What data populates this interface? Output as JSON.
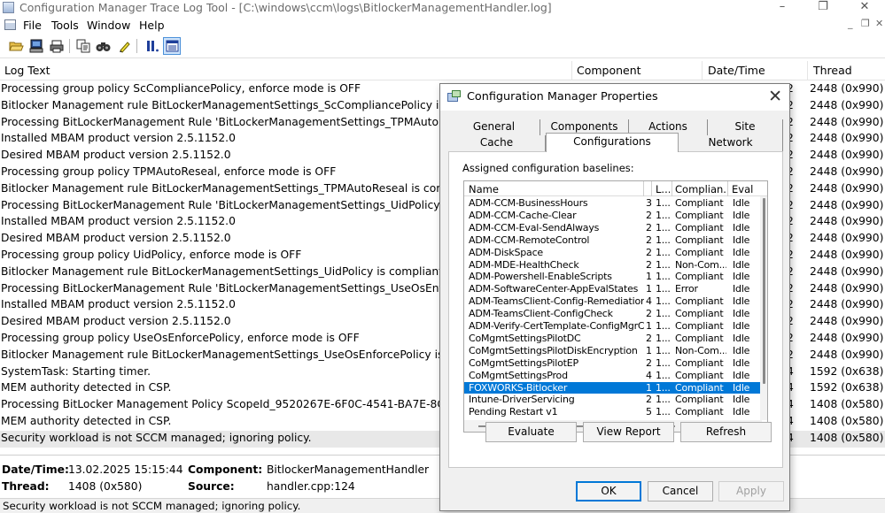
{
  "window": {
    "title": "Configuration Manager Trace Log Tool - [C:\\windows\\ccm\\logs\\BitlockerManagementHandler.log]",
    "controls": [
      "–",
      "❐",
      "✕"
    ]
  },
  "menu": {
    "items": [
      "File",
      "Tools",
      "Window",
      "Help"
    ],
    "mdi_controls": [
      "_",
      "❐",
      "✕"
    ]
  },
  "toolbar": {
    "icons": [
      "open-icon",
      "computer-icon",
      "print-icon",
      "copy-icon",
      "find-icon",
      "highlight-icon",
      "pause-icon",
      "view-details-icon"
    ]
  },
  "log": {
    "columns": [
      "Log Text",
      "Component",
      "Date/Time",
      "Thread"
    ],
    "rows": [
      {
        "text": "Processing group policy ScCompliancePolicy, enforce mode is OFF",
        "dt": "2",
        "thread": "2448 (0x990)"
      },
      {
        "text": "Bitlocker Management rule BitLockerManagementSettings_ScCompliancePolicy is compliant",
        "dt": "2",
        "thread": "2448 (0x990)"
      },
      {
        "text": "Processing BitLockerManagement Rule 'BitLockerManagementSettings_TPMAutoReseal'. Enforcement",
        "dt": "2",
        "thread": "2448 (0x990)"
      },
      {
        "text": "Installed MBAM product version 2.5.1152.0",
        "dt": "2",
        "thread": "2448 (0x990)"
      },
      {
        "text": "Desired MBAM product version 2.5.1152.0",
        "dt": "2",
        "thread": "2448 (0x990)"
      },
      {
        "text": "Processing group policy TPMAutoReseal, enforce mode is OFF",
        "dt": "2",
        "thread": "2448 (0x990)"
      },
      {
        "text": "Bitlocker Management rule BitLockerManagementSettings_TPMAutoReseal is compliant",
        "dt": "2",
        "thread": "2448 (0x990)"
      },
      {
        "text": "Processing BitLockerManagement Rule 'BitLockerManagementSettings_UidPolicy'. Enforcement",
        "dt": "2",
        "thread": "2448 (0x990)"
      },
      {
        "text": "Installed MBAM product version 2.5.1152.0",
        "dt": "2",
        "thread": "2448 (0x990)"
      },
      {
        "text": "Desired MBAM product version 2.5.1152.0",
        "dt": "2",
        "thread": "2448 (0x990)"
      },
      {
        "text": "Processing group policy UidPolicy, enforce mode is OFF",
        "dt": "2",
        "thread": "2448 (0x990)"
      },
      {
        "text": "Bitlocker Management rule BitLockerManagementSettings_UidPolicy is compliant",
        "dt": "2",
        "thread": "2448 (0x990)"
      },
      {
        "text": "Processing BitLockerManagement Rule 'BitLockerManagementSettings_UseOsEnforcePolicy'. Enforcement",
        "dt": "2",
        "thread": "2448 (0x990)"
      },
      {
        "text": "Installed MBAM product version 2.5.1152.0",
        "dt": "2",
        "thread": "2448 (0x990)"
      },
      {
        "text": "Desired MBAM product version 2.5.1152.0",
        "dt": "2",
        "thread": "2448 (0x990)"
      },
      {
        "text": "Processing group policy UseOsEnforcePolicy, enforce mode is OFF",
        "dt": "2",
        "thread": "2448 (0x990)"
      },
      {
        "text": "Bitlocker Management rule BitLockerManagementSettings_UseOsEnforcePolicy is compliant",
        "dt": "2",
        "thread": "2448 (0x990)"
      },
      {
        "text": "SystemTask: Starting timer.",
        "dt": "4",
        "thread": "1592 (0x638)"
      },
      {
        "text": "MEM authority detected in CSP.",
        "dt": "4",
        "thread": "1592 (0x638)"
      },
      {
        "text": "Processing BitLocker Management Policy ScopeId_9520267E-6F0C-4541-BA7E-8C7F95586189/C",
        "dt": "4",
        "thread": "1408 (0x580)"
      },
      {
        "text": "MEM authority detected in CSP.",
        "dt": "4",
        "thread": "1408 (0x580)"
      },
      {
        "text": "Security workload is not SCCM managed; ignoring policy.",
        "dt": "4",
        "thread": "1408 (0x580)"
      }
    ],
    "selected_index": 21
  },
  "details": {
    "datetime_label": "Date/Time:",
    "datetime_value": "13.02.2025 15:15:44",
    "component_label": "Component:",
    "component_value": "BitlockerManagementHandler",
    "thread_label": "Thread:",
    "thread_value": "1408 (0x580)",
    "source_label": "Source:",
    "source_value": "handler.cpp:124"
  },
  "status": {
    "text": "Security workload is not SCCM managed; ignoring policy."
  },
  "dialog": {
    "title": "Configuration Manager Properties",
    "close": "✕",
    "tabs_top": [
      "General",
      "Components",
      "Actions",
      "Site"
    ],
    "tabs_bottom": [
      "Cache",
      "Configurations",
      "Network"
    ],
    "active_tab": "Configurations",
    "panel_label": "Assigned configuration baselines:",
    "list_columns": [
      "Name",
      "",
      "L...",
      "Complian...",
      "Eval"
    ],
    "baselines": [
      {
        "name": "ADM-CCM-BusinessHours",
        "rev": "3",
        "lastEval": "1...",
        "compliance": "Compliant",
        "eval": "Idle"
      },
      {
        "name": "ADM-CCM-Cache-Clear",
        "rev": "2",
        "lastEval": "1...",
        "compliance": "Compliant",
        "eval": "Idle"
      },
      {
        "name": "ADM-CCM-Eval-SendAlways",
        "rev": "2",
        "lastEval": "1...",
        "compliance": "Compliant",
        "eval": "Idle"
      },
      {
        "name": "ADM-CCM-RemoteControl",
        "rev": "2",
        "lastEval": "1...",
        "compliance": "Compliant",
        "eval": "Idle"
      },
      {
        "name": "ADM-DiskSpace",
        "rev": "2",
        "lastEval": "1...",
        "compliance": "Compliant",
        "eval": "Idle"
      },
      {
        "name": "ADM-MDE-HealthCheck",
        "rev": "2",
        "lastEval": "1...",
        "compliance": "Non-Com...",
        "eval": "Idle"
      },
      {
        "name": "ADM-Powershell-EnableScripts",
        "rev": "1",
        "lastEval": "1...",
        "compliance": "Compliant",
        "eval": "Idle"
      },
      {
        "name": "ADM-SoftwareCenter-AppEvalStates",
        "rev": "1",
        "lastEval": "1...",
        "compliance": "Error",
        "eval": "Idle"
      },
      {
        "name": "ADM-TeamsClient-Config-Remediation",
        "rev": "4",
        "lastEval": "1...",
        "compliance": "Compliant",
        "eval": "Idle"
      },
      {
        "name": "ADM-TeamsClient-ConfigCheck",
        "rev": "2",
        "lastEval": "1...",
        "compliance": "Compliant",
        "eval": "Idle"
      },
      {
        "name": "ADM-Verify-CertTemplate-ConfigMgrClient",
        "rev": "1",
        "lastEval": "1...",
        "compliance": "Compliant",
        "eval": "Idle"
      },
      {
        "name": "CoMgmtSettingsPilotDC",
        "rev": "2",
        "lastEval": "1...",
        "compliance": "Compliant",
        "eval": "Idle"
      },
      {
        "name": "CoMgmtSettingsPilotDiskEncryption",
        "rev": "1",
        "lastEval": "1...",
        "compliance": "Non-Com...",
        "eval": "Idle"
      },
      {
        "name": "CoMgmtSettingsPilotEP",
        "rev": "2",
        "lastEval": "1...",
        "compliance": "Compliant",
        "eval": "Idle"
      },
      {
        "name": "CoMgmtSettingsProd",
        "rev": "4",
        "lastEval": "1...",
        "compliance": "Compliant",
        "eval": "Idle"
      },
      {
        "name": "FOXWORKS-Bitlocker",
        "rev": "1",
        "lastEval": "1...",
        "compliance": "Compliant",
        "eval": "Idle"
      },
      {
        "name": "Intune-DriverServicing",
        "rev": "2",
        "lastEval": "1...",
        "compliance": "Compliant",
        "eval": "Idle"
      },
      {
        "name": "Pending Restart v1",
        "rev": "5",
        "lastEval": "1...",
        "compliance": "Compliant",
        "eval": "Idle"
      }
    ],
    "selected_index": 15,
    "buttons": {
      "evaluate": "Evaluate",
      "view_report": "View Report",
      "refresh": "Refresh",
      "ok": "OK",
      "cancel": "Cancel",
      "apply": "Apply"
    },
    "colors": {
      "selection": "#0078d7",
      "default_button_border": "#0078d7"
    }
  }
}
